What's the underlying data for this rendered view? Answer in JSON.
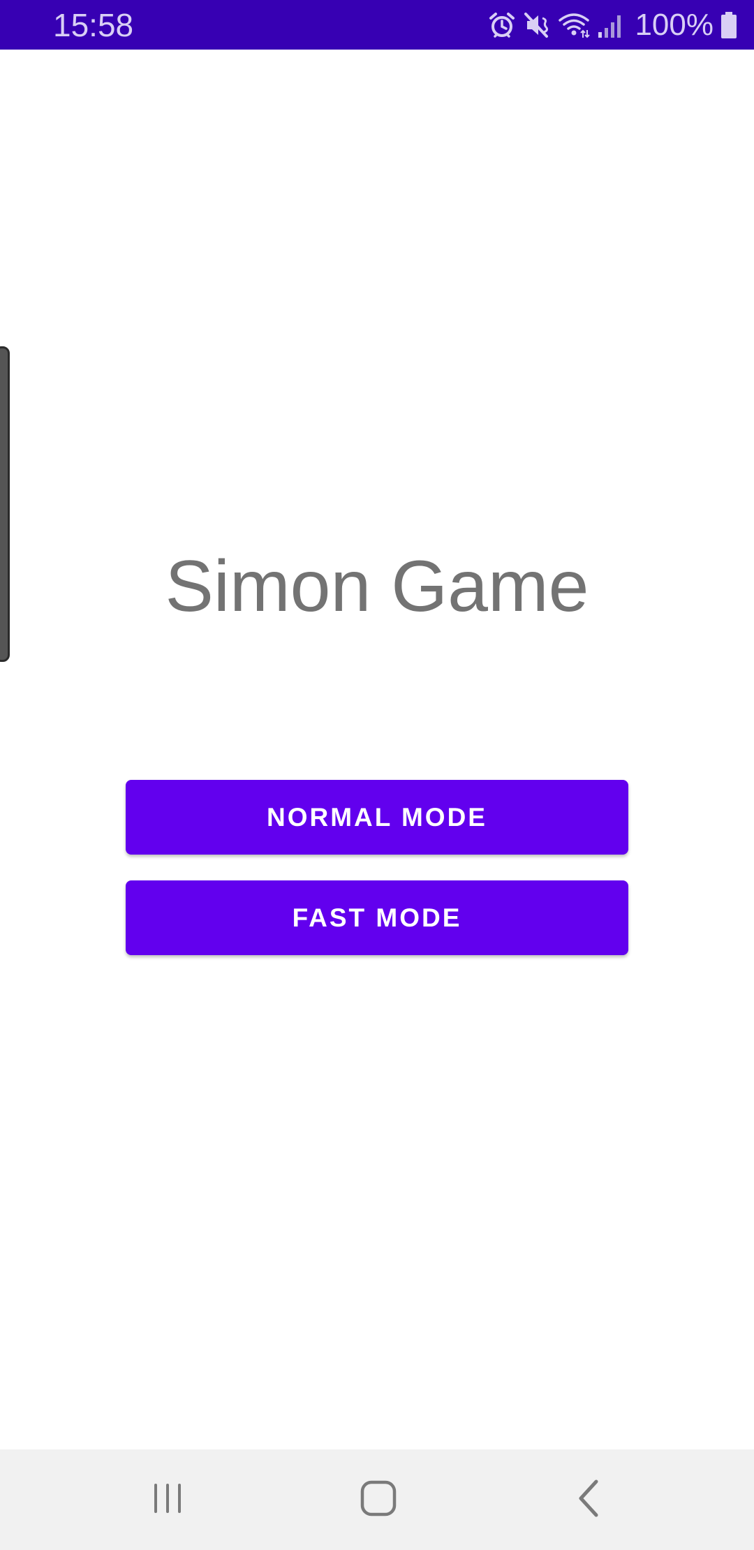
{
  "status_bar": {
    "time": "15:58",
    "battery_percent": "100%",
    "icons": [
      "alarm-icon",
      "mute-icon",
      "wifi-icon",
      "signal-icon",
      "battery-icon"
    ],
    "color": "#3700B3"
  },
  "main": {
    "title": "Simon Game",
    "buttons": {
      "normal_mode": "NORMAL MODE",
      "fast_mode": "FAST MODE"
    },
    "button_color": "#6200EE"
  },
  "nav_bar": {
    "icons": [
      "recents-icon",
      "home-icon",
      "back-icon"
    ]
  }
}
